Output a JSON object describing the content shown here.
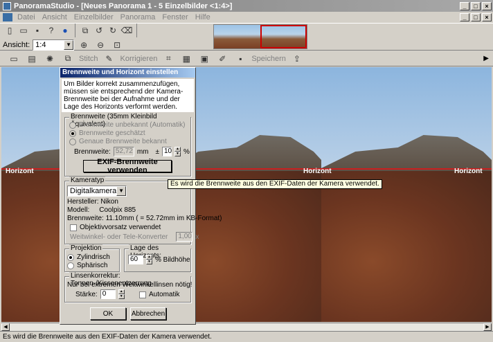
{
  "window": {
    "title": "PanoramaStudio - [Neues Panorama 1 - 5 Einzelbilder <1:4>]",
    "buttons": [
      "_",
      "□",
      "×"
    ]
  },
  "menu": {
    "items": [
      "Datei",
      "Ansicht",
      "Einzelbilder",
      "Panorama",
      "Fenster",
      "Hilfe"
    ]
  },
  "toolbar": {
    "view_label": "Ansicht:",
    "view_value": "1:4",
    "stitch_label": "Stitch",
    "correct_label": "Korrigieren",
    "save_label": "Speichern"
  },
  "canvas": {
    "horizon_label": "Horizont"
  },
  "dialog": {
    "title": "Brennweite und Horizont einstellen",
    "info": "Um Bilder korrekt zusammenzufügen, müssen sie entsprechend der Kamera-Brennweite bei der Aufnahme und der Lage des Horizonts verformt werden.",
    "focal_group": "Brennweite (35mm Kleinbild Äquivalent)",
    "radio_auto": "Brennweite unbekannt (Automatik)",
    "radio_est": "Brennweite geschätzt",
    "radio_exact": "Genaue Brennweite bekannt",
    "focal_label": "Brennweite:",
    "focal_value": "52,72",
    "focal_unit": "mm",
    "pm": "±",
    "tol_value": "10",
    "tol_unit": "%",
    "exif_button": "EXIF-Brennweite verwenden",
    "cam_group": "Kameratyp",
    "cam_value": "Digitalkamera",
    "maker": "Hersteller: Nikon",
    "model_label": "Modell:",
    "model_value": "Coolpix 885",
    "focal_info": "Brennweite: 11.10mm ( = 52.72mm im KB-Format)",
    "lens_check": "Objektivvorsatz verwendet",
    "converter_label": "Weitwinkel- oder Tele-Konverter",
    "converter_value": "1,00",
    "converter_x": "x",
    "proj_group": "Projektion",
    "proj_cyl": "Zylindrisch",
    "proj_sph": "Sphärisch",
    "horizon_group": "Lage des Horizonts:",
    "horizon_value": "60",
    "horizon_unit": "% Bildhöhe",
    "lens_group": "Linsenkorrektur: Tonnen-/Kissenentzerrung",
    "lens_note": "Nur bei extremen Weitwinkellinsen nötig!",
    "strength_label": "Stärke:",
    "strength_value": "0",
    "auto_check": "Automatik",
    "ok": "OK",
    "cancel": "Abbrechen"
  },
  "tooltip": "Es wird die Brennweite aus den EXIF-Daten der Kamera verwendet.",
  "status": "Es wird die Brennweite aus den EXIF-Daten der Kamera verwendet."
}
